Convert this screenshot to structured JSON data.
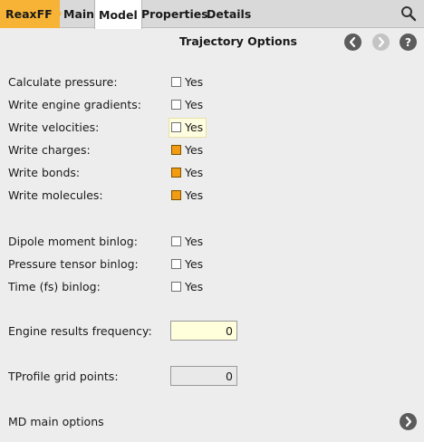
{
  "tabs": {
    "breadcrumb": "ReaxFF",
    "main": "Main",
    "model": "Model",
    "properties": "Properties",
    "details": "Details"
  },
  "header": {
    "title": "Trajectory Options"
  },
  "trajectory": {
    "calculate_pressure": {
      "label": "Calculate pressure:",
      "value": "Yes",
      "checked": false
    },
    "write_engine_gradients": {
      "label": "Write engine gradients:",
      "value": "Yes",
      "checked": false
    },
    "write_velocities": {
      "label": "Write velocities:",
      "value": "Yes",
      "checked": false
    },
    "write_charges": {
      "label": "Write charges:",
      "value": "Yes",
      "checked": true
    },
    "write_bonds": {
      "label": "Write bonds:",
      "value": "Yes",
      "checked": true
    },
    "write_molecules": {
      "label": "Write molecules:",
      "value": "Yes",
      "checked": true
    }
  },
  "binlog": {
    "dipole_moment": {
      "label": "Dipole moment binlog:",
      "value": "Yes",
      "checked": false
    },
    "pressure_tensor": {
      "label": "Pressure tensor binlog:",
      "value": "Yes",
      "checked": false
    },
    "time": {
      "label": "Time (fs) binlog:",
      "value": "Yes",
      "checked": false
    }
  },
  "engine_results_frequency": {
    "label": "Engine results frequency:",
    "value": "0"
  },
  "tprofile_grid_points": {
    "label": "TProfile grid points:",
    "value": "0"
  },
  "md_main_options": {
    "label": "MD main options"
  },
  "colors": {
    "accent": "#f6b335",
    "checked": "#f39c12",
    "background": "#ededed",
    "tabbar": "#d9d9d9"
  },
  "icons": {
    "search": "search-icon",
    "back": "chevron-left-icon",
    "forward": "chevron-right-icon",
    "help": "help-icon",
    "next": "chevron-right-icon"
  }
}
